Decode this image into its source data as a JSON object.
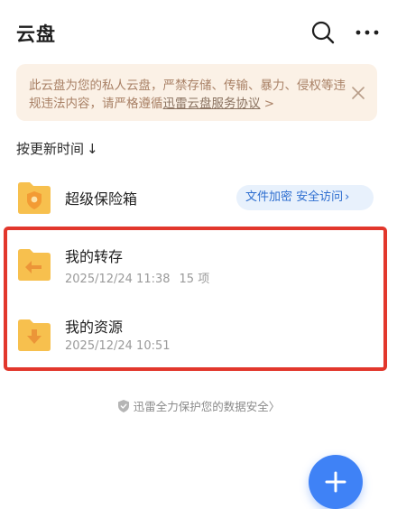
{
  "header": {
    "title": "云盘",
    "icons": {
      "search": "search-icon",
      "more": "more-dots-icon"
    }
  },
  "notice": {
    "text": "此云盘为您的私人云盘，严禁存储、传输、暴力、侵权等违规违法内容，请严格遵循",
    "link_text": "迅雷云盘服务协议",
    "link_suffix": " >",
    "close_icon": "close-icon"
  },
  "sort": {
    "label": "按更新时间",
    "arrow": "↓"
  },
  "items": [
    {
      "name": "超级保险箱",
      "icon": "safe-folder-icon",
      "pill": "文件加密 安全访问",
      "pill_chevron": "›"
    },
    {
      "name": "我的转存",
      "icon": "transfer-folder-icon",
      "date": "2025/12/24 11:38",
      "count": "15 项"
    },
    {
      "name": "我的资源",
      "icon": "download-folder-icon",
      "date": "2025/12/24 10:51"
    }
  ],
  "footer": {
    "text": "迅雷全力保护您的数据安全",
    "chevron": "〉"
  },
  "fab": {
    "icon": "plus-icon"
  },
  "colors": {
    "accent": "#3f82f6",
    "folder": "#f7c04e",
    "notice_bg": "#fbf1e6",
    "highlight": "#e2372c"
  }
}
